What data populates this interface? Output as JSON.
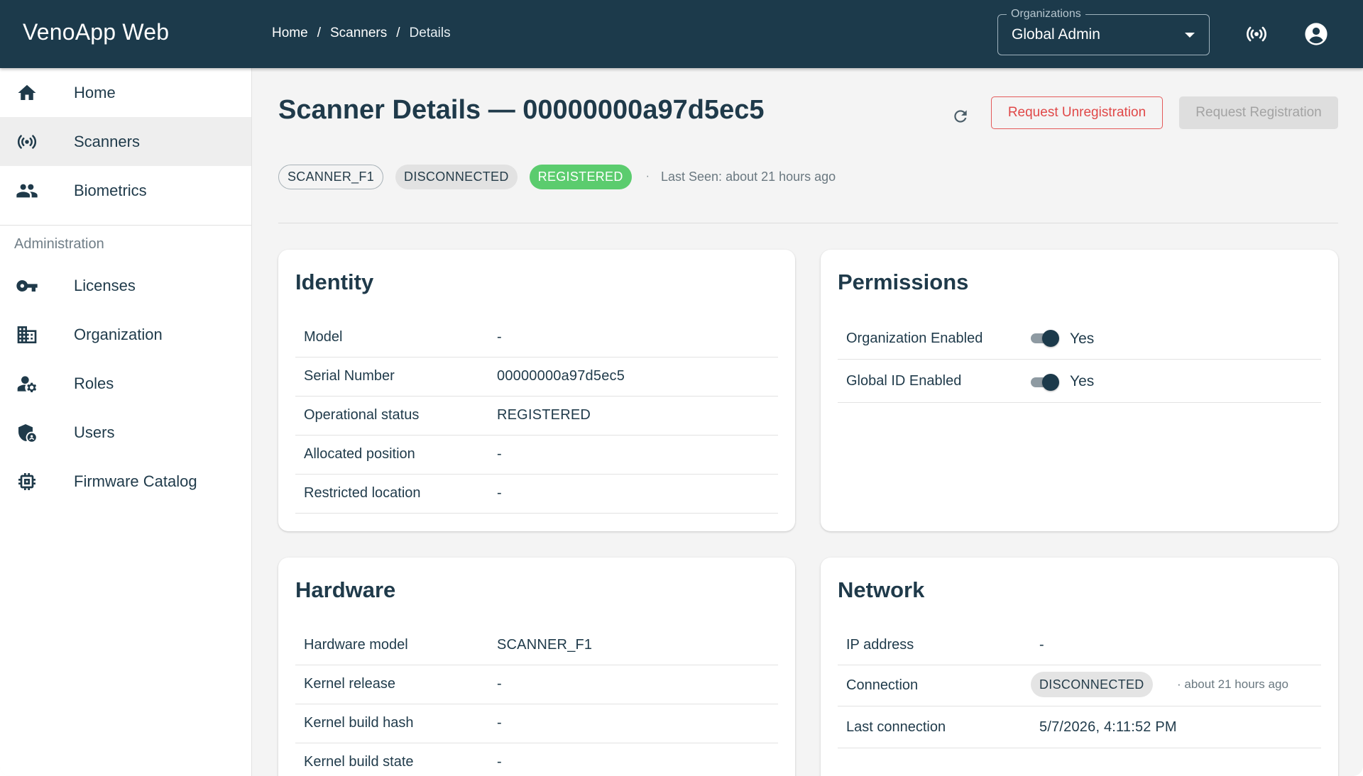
{
  "app": {
    "title": "VenoApp Web"
  },
  "breadcrumb": [
    "Home",
    "Scanners",
    "Details"
  ],
  "org_select": {
    "legend": "Organizations",
    "value": "Global Admin"
  },
  "sidebar": {
    "items": [
      {
        "label": "Home",
        "icon": "home-icon"
      },
      {
        "label": "Scanners",
        "icon": "broadcast-icon",
        "active": true
      },
      {
        "label": "Biometrics",
        "icon": "people-icon"
      }
    ],
    "section_label": "Administration",
    "admin_items": [
      {
        "label": "Licenses",
        "icon": "key-icon"
      },
      {
        "label": "Organization",
        "icon": "building-icon"
      },
      {
        "label": "Roles",
        "icon": "user-gear-icon"
      },
      {
        "label": "Users",
        "icon": "shield-user-icon"
      },
      {
        "label": "Firmware Catalog",
        "icon": "chip-icon"
      }
    ]
  },
  "page": {
    "title": "Scanner Details — 00000000a97d5ec5",
    "unregister_label": "Request Unregistration",
    "register_label": "Request Registration",
    "chips": {
      "model": "SCANNER_F1",
      "connection": "DISCONNECTED",
      "status": "REGISTERED"
    },
    "separator": "·",
    "last_seen": "Last Seen: about 21 hours ago"
  },
  "identity": {
    "title": "Identity",
    "rows": [
      {
        "key": "Model",
        "value": "-"
      },
      {
        "key": "Serial Number",
        "value": "00000000a97d5ec5"
      },
      {
        "key": "Operational status",
        "value": "REGISTERED"
      },
      {
        "key": "Allocated position",
        "value": "-"
      },
      {
        "key": "Restricted location",
        "value": "-"
      }
    ]
  },
  "permissions": {
    "title": "Permissions",
    "rows": [
      {
        "key": "Organization Enabled",
        "value": "Yes",
        "enabled": true
      },
      {
        "key": "Global ID Enabled",
        "value": "Yes",
        "enabled": true
      }
    ]
  },
  "hardware": {
    "title": "Hardware",
    "rows": [
      {
        "key": "Hardware model",
        "value": "SCANNER_F1"
      },
      {
        "key": "Kernel release",
        "value": "-"
      },
      {
        "key": "Kernel build hash",
        "value": "-"
      },
      {
        "key": "Kernel build state",
        "value": "-"
      }
    ]
  },
  "network": {
    "title": "Network",
    "ip": {
      "key": "IP address",
      "value": "-"
    },
    "connection": {
      "key": "Connection",
      "chip": "DISCONNECTED",
      "ago": "· about 21 hours ago"
    },
    "last_connection": {
      "key": "Last connection",
      "value": "5/7/2026, 4:11:52 PM"
    }
  },
  "colors": {
    "topbar": "#1c3a4b",
    "accent_danger": "#e04848",
    "status_green": "#5bcc6e"
  }
}
